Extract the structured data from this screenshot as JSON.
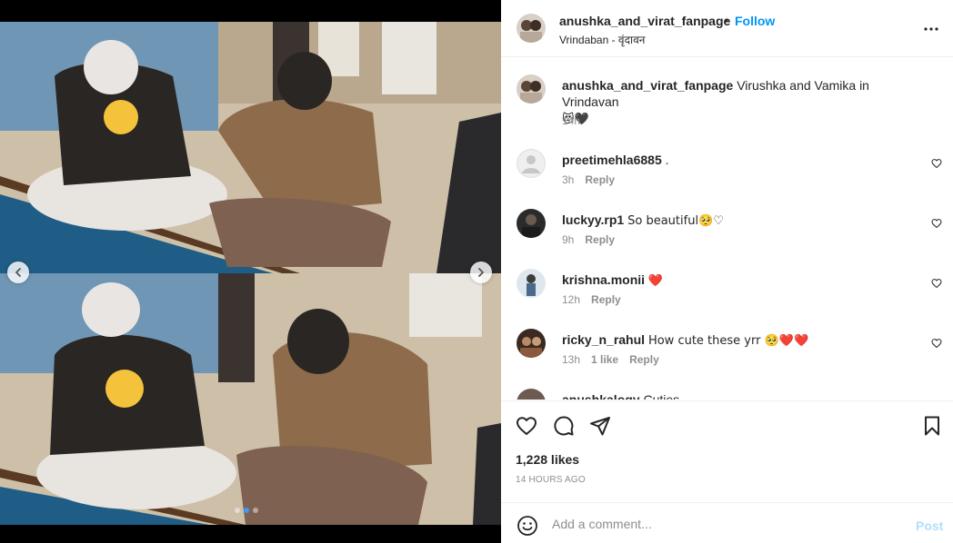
{
  "post": {
    "username": "anushka_and_virat_fanpage",
    "follow_label": "Follow",
    "separator": "•",
    "location": "Vrindaban - वृंदावन"
  },
  "caption": {
    "username": "anushka_and_virat_fanpage",
    "text": "Virushka and Vamika in Vrindavan",
    "emojis": "😻🖤",
    "time": "14h"
  },
  "comments": [
    {
      "username": "preetimehla6885",
      "text": ".",
      "time": "3h",
      "likes": "",
      "reply": "Reply"
    },
    {
      "username": "luckyy.rp1",
      "text": "So beautiful🥺♡",
      "time": "9h",
      "likes": "",
      "reply": "Reply"
    },
    {
      "username": "krishna.monii",
      "text": "❤️",
      "time": "12h",
      "likes": "",
      "reply": "Reply"
    },
    {
      "username": "ricky_n_rahul",
      "text": "How cute these yrr 🥺❤️❤️",
      "time": "13h",
      "likes": "1 like",
      "reply": "Reply"
    },
    {
      "username": "anushkalogy",
      "text": "Cuties",
      "time": "",
      "likes": "",
      "reply": ""
    }
  ],
  "actions": {
    "likes": "1,228 likes",
    "time_ago": "14 HOURS AGO"
  },
  "add_comment": {
    "placeholder": "Add a comment...",
    "post_label": "Post"
  },
  "colors": {
    "link_blue": "#0095f6",
    "post_disabled": "#b2dffc",
    "muted": "#8e8e8e",
    "heart_red": "#ed4956"
  }
}
